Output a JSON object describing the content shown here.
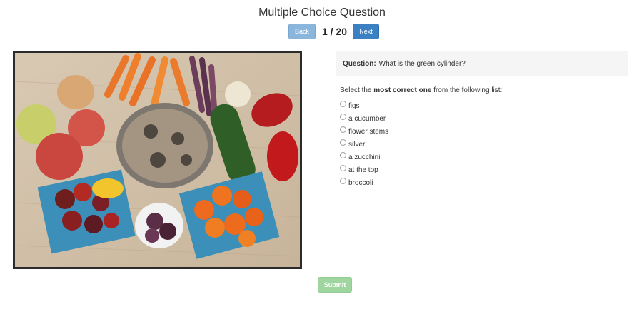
{
  "header": {
    "title": "Multiple Choice Question"
  },
  "nav": {
    "back_label": "Back",
    "counter": "1 / 20",
    "next_label": "Next"
  },
  "question": {
    "prefix": "Question:",
    "text": "What is the green cylinder?",
    "instruction_before": "Select the",
    "instruction_bold": "most correct one",
    "instruction_after": "from the following list:",
    "options": [
      "figs",
      "a cucumber",
      "flower stems",
      "silver",
      "a zucchini",
      "at the top",
      "broccoli"
    ]
  },
  "footer": {
    "submit_label": "Submit"
  },
  "image": {
    "subject": "vegetables-and-fruit-photo"
  },
  "colors": {
    "back_button": "#8bb6dc",
    "next_button": "#3a80c3",
    "submit_button": "#9fd59f",
    "question_box": "#f5f5f5"
  }
}
